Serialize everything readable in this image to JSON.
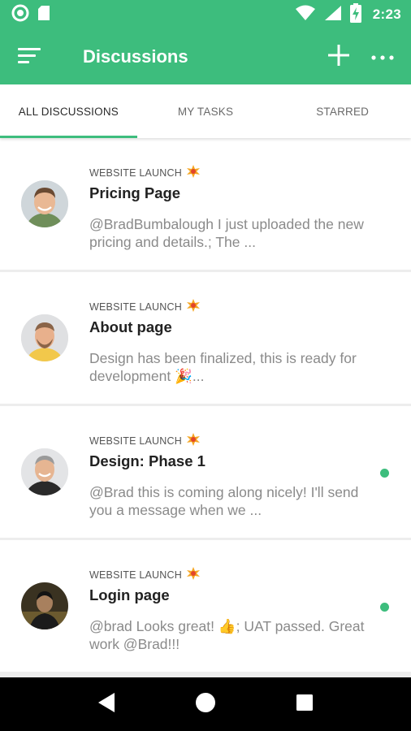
{
  "status_bar": {
    "time": "2:23",
    "icons": [
      "circle-notification-icon",
      "sd-card-icon",
      "wifi-icon",
      "signal-icon",
      "battery-charging-icon"
    ]
  },
  "app_bar": {
    "title": "Discussions",
    "icons": [
      "menu-icon",
      "add-icon",
      "more-icon"
    ]
  },
  "tabs": [
    {
      "label": "ALL DISCUSSIONS",
      "active": true
    },
    {
      "label": "MY TASKS",
      "active": false
    },
    {
      "label": "STARRED",
      "active": false
    }
  ],
  "discussions": [
    {
      "project": "WEBSITE LAUNCH",
      "project_icon": "collision-emoji-icon",
      "title": "Pricing Page",
      "preview": "@BradBumbalough I just uploaded the new pricing and details.; The ...",
      "unread": false
    },
    {
      "project": "WEBSITE LAUNCH",
      "project_icon": "collision-emoji-icon",
      "title": "About page",
      "preview": "Design has been finalized, this is ready for development 🎉...",
      "unread": false
    },
    {
      "project": "WEBSITE LAUNCH",
      "project_icon": "collision-emoji-icon",
      "title": "Design: Phase 1",
      "preview": "@Brad this is coming along nicely! I'll send you a message when we ...",
      "unread": true
    },
    {
      "project": "WEBSITE LAUNCH",
      "project_icon": "collision-emoji-icon",
      "title": "Login page",
      "preview": "@brad Looks great! 👍; UAT passed. Great work @Brad!!!",
      "unread": true
    }
  ],
  "nav_bar": {
    "icons": [
      "back-icon",
      "home-icon",
      "recents-icon"
    ]
  },
  "colors": {
    "brand": "#3dbd7d",
    "divider": "#ededed",
    "preview_text": "#8a8a8a"
  }
}
